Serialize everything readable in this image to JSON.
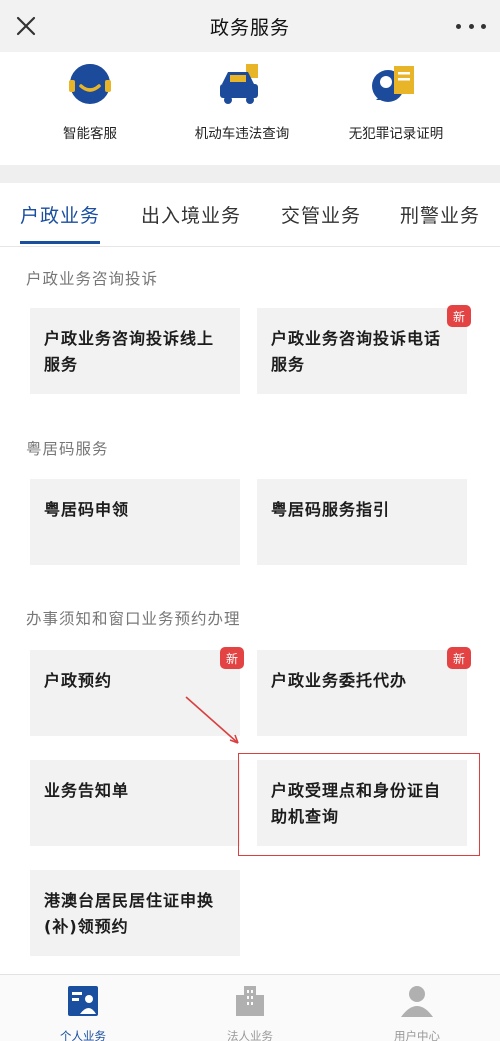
{
  "header": {
    "title": "政务服务"
  },
  "quick_services": [
    {
      "label": "智能客服",
      "icon": "smart-service-icon"
    },
    {
      "label": "机动车违法查询",
      "icon": "vehicle-violation-icon"
    },
    {
      "label": "无犯罪记录证明",
      "icon": "no-criminal-record-icon"
    }
  ],
  "tabs": [
    {
      "label": "户政业务",
      "active": true
    },
    {
      "label": "出入境业务",
      "active": false
    },
    {
      "label": "交管业务",
      "active": false
    },
    {
      "label": "刑警业务",
      "active": false
    }
  ],
  "sections": [
    {
      "title": "户政业务咨询投诉",
      "cards": [
        {
          "label": "户政业务咨询投诉线上服务",
          "badge": ""
        },
        {
          "label": "户政业务咨询投诉电话服务",
          "badge": "新"
        }
      ]
    },
    {
      "title": "粤居码服务",
      "cards": [
        {
          "label": "粤居码申领",
          "badge": ""
        },
        {
          "label": "粤居码服务指引",
          "badge": ""
        }
      ]
    },
    {
      "title": "办事须知和窗口业务预约办理",
      "cards": [
        {
          "label": "户政预约",
          "badge": "新"
        },
        {
          "label": "户政业务委托代办",
          "badge": "新"
        },
        {
          "label": "业务告知单",
          "badge": ""
        },
        {
          "label": "户政受理点和身份证自助机查询",
          "badge": ""
        },
        {
          "label": "港澳台居民居住证申换(补)领预约",
          "badge": ""
        }
      ]
    }
  ],
  "bottom_nav": [
    {
      "label": "个人业务",
      "icon": "personal-business-icon",
      "active": true
    },
    {
      "label": "法人业务",
      "icon": "legal-entity-business-icon",
      "active": false
    },
    {
      "label": "用户中心",
      "icon": "user-center-icon",
      "active": false
    }
  ],
  "colors": {
    "accent": "#1a4fa0",
    "badge": "#e34343",
    "highlight": "#d9403f",
    "card_bg": "#f2f2f2"
  }
}
